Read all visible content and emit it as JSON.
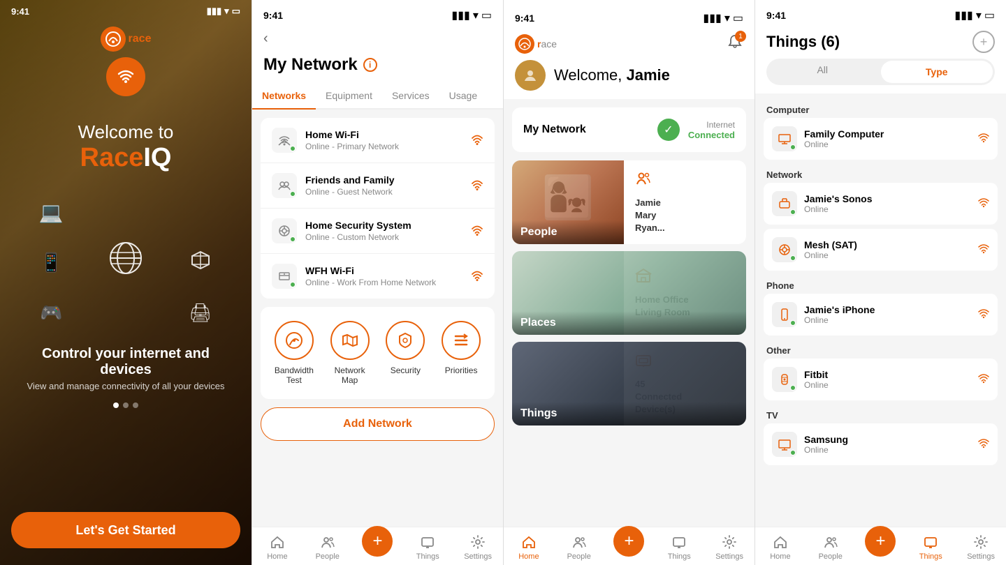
{
  "screen1": {
    "status_time": "9:41",
    "logo_text": "ace",
    "welcome_line1": "Welcome to",
    "brand_name": "Race|IQ",
    "control_text": "Control your internet and devices",
    "subtitle": "View and manage connectivity of all your devices",
    "cta_button": "Let's Get Started",
    "dots": [
      true,
      false,
      false
    ]
  },
  "screen2": {
    "status_time": "9:41",
    "title": "My Network",
    "tabs": [
      "Networks",
      "Equipment",
      "Services",
      "Usage"
    ],
    "active_tab": "Networks",
    "networks": [
      {
        "name": "Home Wi-Fi",
        "sub": "Online - Primary Network",
        "icon": "🏠"
      },
      {
        "name": "Friends and Family",
        "sub": "Online - Guest Network",
        "icon": "👥"
      },
      {
        "name": "Home Security System",
        "sub": "Online - Custom Network",
        "icon": "⚙️"
      },
      {
        "name": "WFH Wi-Fi",
        "sub": "Online - Work From Home Network",
        "icon": "💼"
      }
    ],
    "quick_actions": [
      {
        "label": "Bandwidth\nTest",
        "icon": "⟳"
      },
      {
        "label": "Network\nMap",
        "icon": "🗺"
      },
      {
        "label": "Security",
        "icon": "🛡"
      },
      {
        "label": "Priorities",
        "icon": "≡"
      }
    ],
    "add_network": "Add Network",
    "nav": [
      {
        "label": "Home",
        "icon": "⌂",
        "active": false
      },
      {
        "label": "People",
        "icon": "👥",
        "active": false
      },
      {
        "label": "+",
        "icon": "+",
        "active": false
      },
      {
        "label": "Things",
        "icon": "📱",
        "active": false
      },
      {
        "label": "Settings",
        "icon": "⚙",
        "active": false
      }
    ]
  },
  "screen3": {
    "status_time": "9:41",
    "logo_text": "ace",
    "welcome": "Welcome, ",
    "name": "Jamie",
    "bell_count": "1",
    "network_name": "My Network",
    "internet_label": "Internet",
    "connected_label": "Connected",
    "cards": [
      {
        "title": "People",
        "info_icon": "👥",
        "info_lines": [
          "Jamie",
          "Mary",
          "Ryan..."
        ]
      },
      {
        "title": "Places",
        "info_icon": "🖥",
        "info_lines": [
          "Home Office",
          "Living Room"
        ]
      },
      {
        "title": "Things",
        "info_icon": "🖥",
        "info_lines": [
          "45",
          "Connected",
          "Device(s)"
        ]
      }
    ],
    "nav": [
      {
        "label": "Home",
        "active": true
      },
      {
        "label": "People",
        "active": false
      },
      {
        "label": "+",
        "active": false
      },
      {
        "label": "Things",
        "active": false
      },
      {
        "label": "Settings",
        "active": false
      }
    ]
  },
  "screen4": {
    "status_time": "9:41",
    "title": "Things (6)",
    "filters": [
      "All",
      "Type"
    ],
    "active_filter": "Type",
    "categories": [
      {
        "name": "Computer",
        "items": [
          {
            "name": "Family Computer",
            "status": "Online",
            "icon": "💻"
          }
        ]
      },
      {
        "name": "Network",
        "items": [
          {
            "name": "Jamie's Sonos",
            "status": "Online",
            "icon": "📡"
          },
          {
            "name": "Mesh (SAT)",
            "status": "Online",
            "icon": "⚙️"
          }
        ]
      },
      {
        "name": "Phone",
        "items": [
          {
            "name": "Jamie's iPhone",
            "status": "Online",
            "icon": "📱"
          }
        ]
      },
      {
        "name": "Other",
        "items": [
          {
            "name": "Fitbit",
            "status": "Online",
            "icon": "📱"
          }
        ]
      },
      {
        "name": "TV",
        "items": [
          {
            "name": "Samsung",
            "status": "Online",
            "icon": "🖥"
          }
        ]
      }
    ],
    "nav": [
      {
        "label": "Home",
        "active": false
      },
      {
        "label": "People",
        "active": false
      },
      {
        "label": "+",
        "active": false
      },
      {
        "label": "Things",
        "active": true
      },
      {
        "label": "Settings",
        "active": false
      }
    ]
  }
}
